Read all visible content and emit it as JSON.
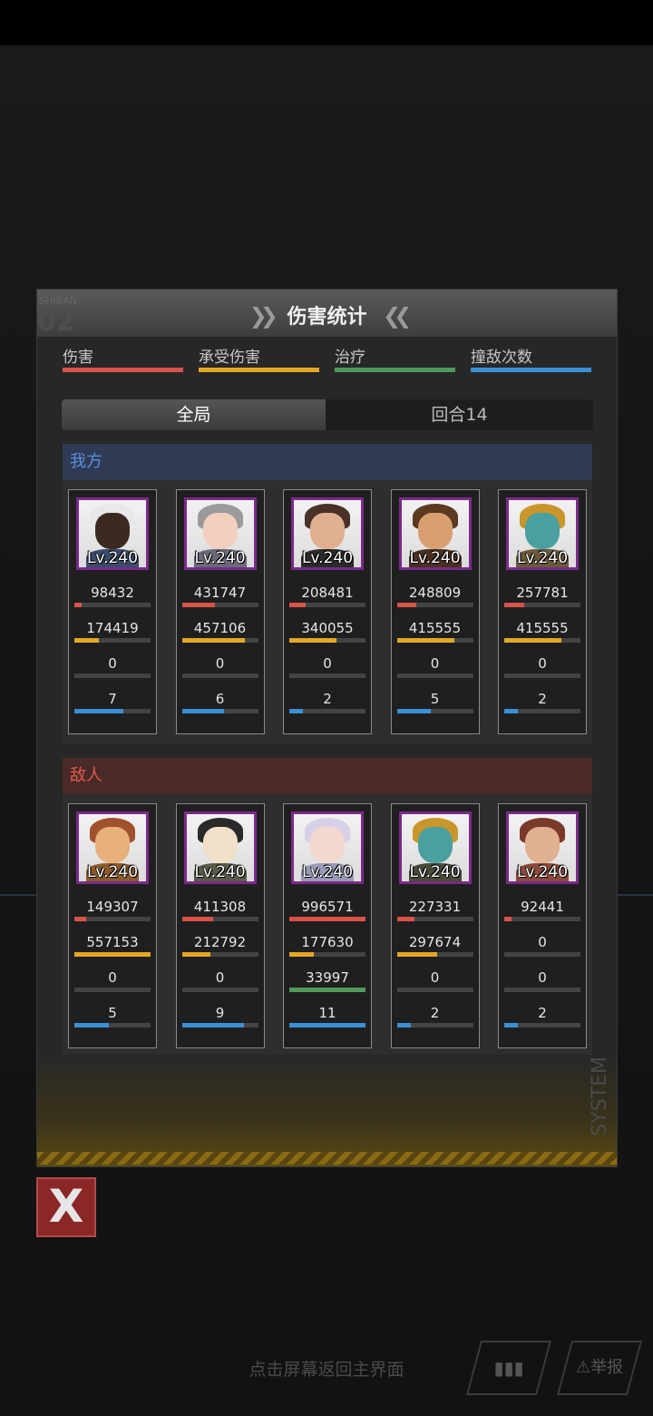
{
  "panel": {
    "title": "伤害统计",
    "deco_text": "SHIBAN",
    "deco_number": "02",
    "side_text": "SYSTEM"
  },
  "legend": [
    {
      "label": "伤害",
      "color": "#d9534a"
    },
    {
      "label": "承受伤害",
      "color": "#e3a823"
    },
    {
      "label": "治疗",
      "color": "#4f9a5a"
    },
    {
      "label": "撞敌次数",
      "color": "#3b8fd6"
    }
  ],
  "tabs": {
    "all": "全局",
    "round": "回合14"
  },
  "allies": {
    "label": "我方",
    "units": [
      {
        "level": "Lv.240",
        "damage": "98432",
        "damage_frac": 0.09,
        "taken": "174419",
        "taken_frac": 0.32,
        "heal": "0",
        "heal_frac": 0,
        "hits": "7",
        "hits_frac": 0.64,
        "portrait": {
          "hair": "#e8e8e8",
          "skin": "#3a2a22",
          "body": "#3a4a6a"
        }
      },
      {
        "level": "Lv.240",
        "damage": "431747",
        "damage_frac": 0.43,
        "taken": "457106",
        "taken_frac": 0.83,
        "heal": "0",
        "heal_frac": 0,
        "hits": "6",
        "hits_frac": 0.55,
        "portrait": {
          "hair": "#9a9a9a",
          "skin": "#f2d0c0",
          "body": "#6a6a7a"
        }
      },
      {
        "level": "Lv.240",
        "damage": "208481",
        "damage_frac": 0.21,
        "taken": "340055",
        "taken_frac": 0.62,
        "heal": "0",
        "heal_frac": 0,
        "hits": "2",
        "hits_frac": 0.18,
        "portrait": {
          "hair": "#4a3228",
          "skin": "#e0b090",
          "body": "#2a2a2a"
        }
      },
      {
        "level": "Lv.240",
        "damage": "248809",
        "damage_frac": 0.25,
        "taken": "415555",
        "taken_frac": 0.75,
        "heal": "0",
        "heal_frac": 0,
        "hits": "5",
        "hits_frac": 0.45,
        "portrait": {
          "hair": "#5a3a20",
          "skin": "#d8a070",
          "body": "#4a3020"
        }
      },
      {
        "level": "Lv.240",
        "damage": "257781",
        "damage_frac": 0.26,
        "taken": "415555",
        "taken_frac": 0.75,
        "heal": "0",
        "heal_frac": 0,
        "hits": "2",
        "hits_frac": 0.18,
        "portrait": {
          "hair": "#c8962a",
          "skin": "#4aa0a0",
          "body": "#6a5a3a"
        }
      }
    ]
  },
  "enemies": {
    "label": "敌人",
    "units": [
      {
        "level": "Lv.240",
        "damage": "149307",
        "damage_frac": 0.15,
        "taken": "557153",
        "taken_frac": 1.0,
        "heal": "0",
        "heal_frac": 0,
        "hits": "5",
        "hits_frac": 0.45,
        "portrait": {
          "hair": "#a0522d",
          "skin": "#e8b07a",
          "body": "#8a5a2a"
        }
      },
      {
        "level": "Lv.240",
        "damage": "411308",
        "damage_frac": 0.41,
        "taken": "212792",
        "taken_frac": 0.38,
        "heal": "0",
        "heal_frac": 0,
        "hits": "9",
        "hits_frac": 0.82,
        "portrait": {
          "hair": "#2a2a2a",
          "skin": "#f0e0c8",
          "body": "#5a5a4a"
        }
      },
      {
        "level": "Lv.240",
        "damage": "996571",
        "damage_frac": 1.0,
        "taken": "177630",
        "taken_frac": 0.32,
        "heal": "33997",
        "heal_frac": 1.0,
        "hits": "11",
        "hits_frac": 1.0,
        "portrait": {
          "hair": "#d8d0e8",
          "skin": "#f4d8d0",
          "body": "#9a9ab8"
        }
      },
      {
        "level": "Lv.240",
        "damage": "227331",
        "damage_frac": 0.23,
        "taken": "297674",
        "taken_frac": 0.53,
        "heal": "0",
        "heal_frac": 0,
        "hits": "2",
        "hits_frac": 0.18,
        "portrait": {
          "hair": "#c8962a",
          "skin": "#4aa0a0",
          "body": "#4a4a3a"
        }
      },
      {
        "level": "Lv.240",
        "damage": "92441",
        "damage_frac": 0.09,
        "taken": "0",
        "taken_frac": 0,
        "heal": "0",
        "heal_frac": 0,
        "hits": "2",
        "hits_frac": 0.18,
        "portrait": {
          "hair": "#7a3a2a",
          "skin": "#e0b090",
          "body": "#8a4a3a"
        }
      }
    ]
  },
  "close_label": "X",
  "hint": "点击屏幕返回主界面",
  "bottom_buttons": [
    {
      "icon": "bar-chart-icon",
      "label": ""
    },
    {
      "icon": "warning-icon",
      "label": "举报"
    }
  ]
}
